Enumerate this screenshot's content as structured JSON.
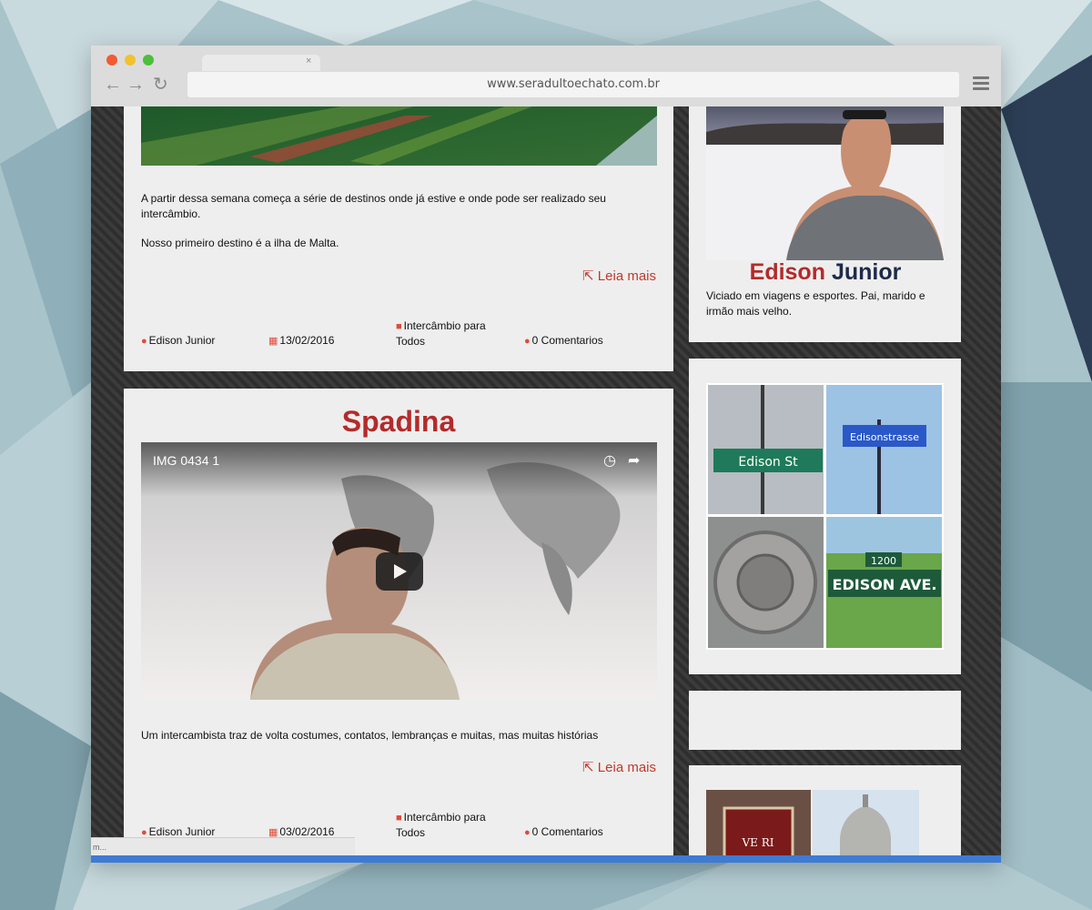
{
  "browser": {
    "url": "www.seradultoechato.com.br",
    "tab_close": "×",
    "back": "←",
    "forward": "→",
    "reload": "↻",
    "status_text": "m..."
  },
  "posts": [
    {
      "paragraphs": [
        "A partir dessa semana começa a série de destinos onde já estive e onde pode ser realizado seu intercâmbio.",
        "Nosso primeiro destino é a ilha de Malta."
      ],
      "read_more": "Leia mais",
      "author": "Edison Junior",
      "date": "13/02/2016",
      "category": "Intercâmbio para Todos",
      "comments": "0 Comentarios"
    },
    {
      "title": "Spadina",
      "video_title": "IMG 0434 1",
      "text": "Um intercambista traz de volta costumes, contatos, lembranças e muitas, mas muitas histórias",
      "read_more": "Leia mais",
      "author": "Edison Junior",
      "date": "03/02/2016",
      "category": "Intercâmbio para Todos",
      "comments": "0 Comentarios"
    }
  ],
  "sidebar": {
    "author_first": "Edison",
    "author_last": "Junior",
    "bio": "Viciado em viagens e esportes. Pai, marido e irmão mais velho.",
    "collage": {
      "sign1": "Edison St",
      "sign2": "Edisonstrasse",
      "sign3_number": "1200",
      "sign3": "EDISON AVE."
    },
    "thumb_text": "VE RI"
  },
  "colors": {
    "accent": "#b52a2a",
    "dark_blue": "#1e2a4a",
    "link": "#c0392b"
  }
}
